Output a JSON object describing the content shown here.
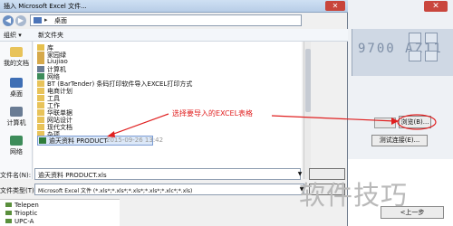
{
  "dialog": {
    "title": "插入 Microsoft Excel 文件...",
    "close_glyph": "✕"
  },
  "address": {
    "path": "桌面",
    "separator": "▸"
  },
  "toolbar": {
    "organize": "组织 ▾",
    "new_folder": "新文件夹"
  },
  "nav_pane": {
    "items": [
      {
        "label": "我的文档",
        "icon": "folder-icon"
      },
      {
        "label": "桌面",
        "icon": "desktop-icon"
      },
      {
        "label": "计算机",
        "icon": "computer-icon"
      },
      {
        "label": "网络",
        "icon": "network-icon"
      }
    ]
  },
  "files": {
    "items": [
      {
        "name": "库",
        "icon": "library-icon"
      },
      {
        "name": "家园绿",
        "icon": "user-folder-icon"
      },
      {
        "name": "Liujiao",
        "icon": "user-folder-icon"
      },
      {
        "name": "计算机",
        "icon": "computer-icon"
      },
      {
        "name": "网络",
        "icon": "network-icon"
      },
      {
        "name": "BT (BarTender) 条码打印软件导入EXCEL打印方式",
        "icon": "folder-icon"
      },
      {
        "name": "电商计划",
        "icon": "folder-icon"
      },
      {
        "name": "工具",
        "icon": "folder-icon"
      },
      {
        "name": "工作",
        "icon": "folder-icon"
      },
      {
        "name": "华联单据",
        "icon": "folder-icon"
      },
      {
        "name": "网站设计",
        "icon": "folder-icon"
      },
      {
        "name": "现代文档",
        "icon": "folder-icon"
      },
      {
        "name": "杂项",
        "icon": "folder-icon"
      }
    ],
    "selected": {
      "name": "逾天资料 PRODUCT",
      "date": "2015-09-26 13:42",
      "icon": "excel-file-icon"
    }
  },
  "annotation": {
    "text": "选择要导入的EXCEL表格",
    "color": "#e02020"
  },
  "filename_field": {
    "label": "文件名(N):",
    "value": "逾天资料 PRODUCT.xls"
  },
  "filetype_field": {
    "label": "文件类型(T):",
    "value": "Microsoft Excel 文件 (*.xls*;*.xls*;*.xls*;*.xls*;*.xlc*;*.xls)"
  },
  "tree": {
    "items": [
      {
        "label": "Telepen"
      },
      {
        "label": "Trioptic"
      },
      {
        "label": "UPC-A"
      }
    ]
  },
  "background_app": {
    "browse_button": "浏览(B)...",
    "test_button": "测试连接(E)...",
    "prev_button": "<上一步",
    "toolbar_digits": "9700 AZ11"
  },
  "watermark": "软件技巧"
}
